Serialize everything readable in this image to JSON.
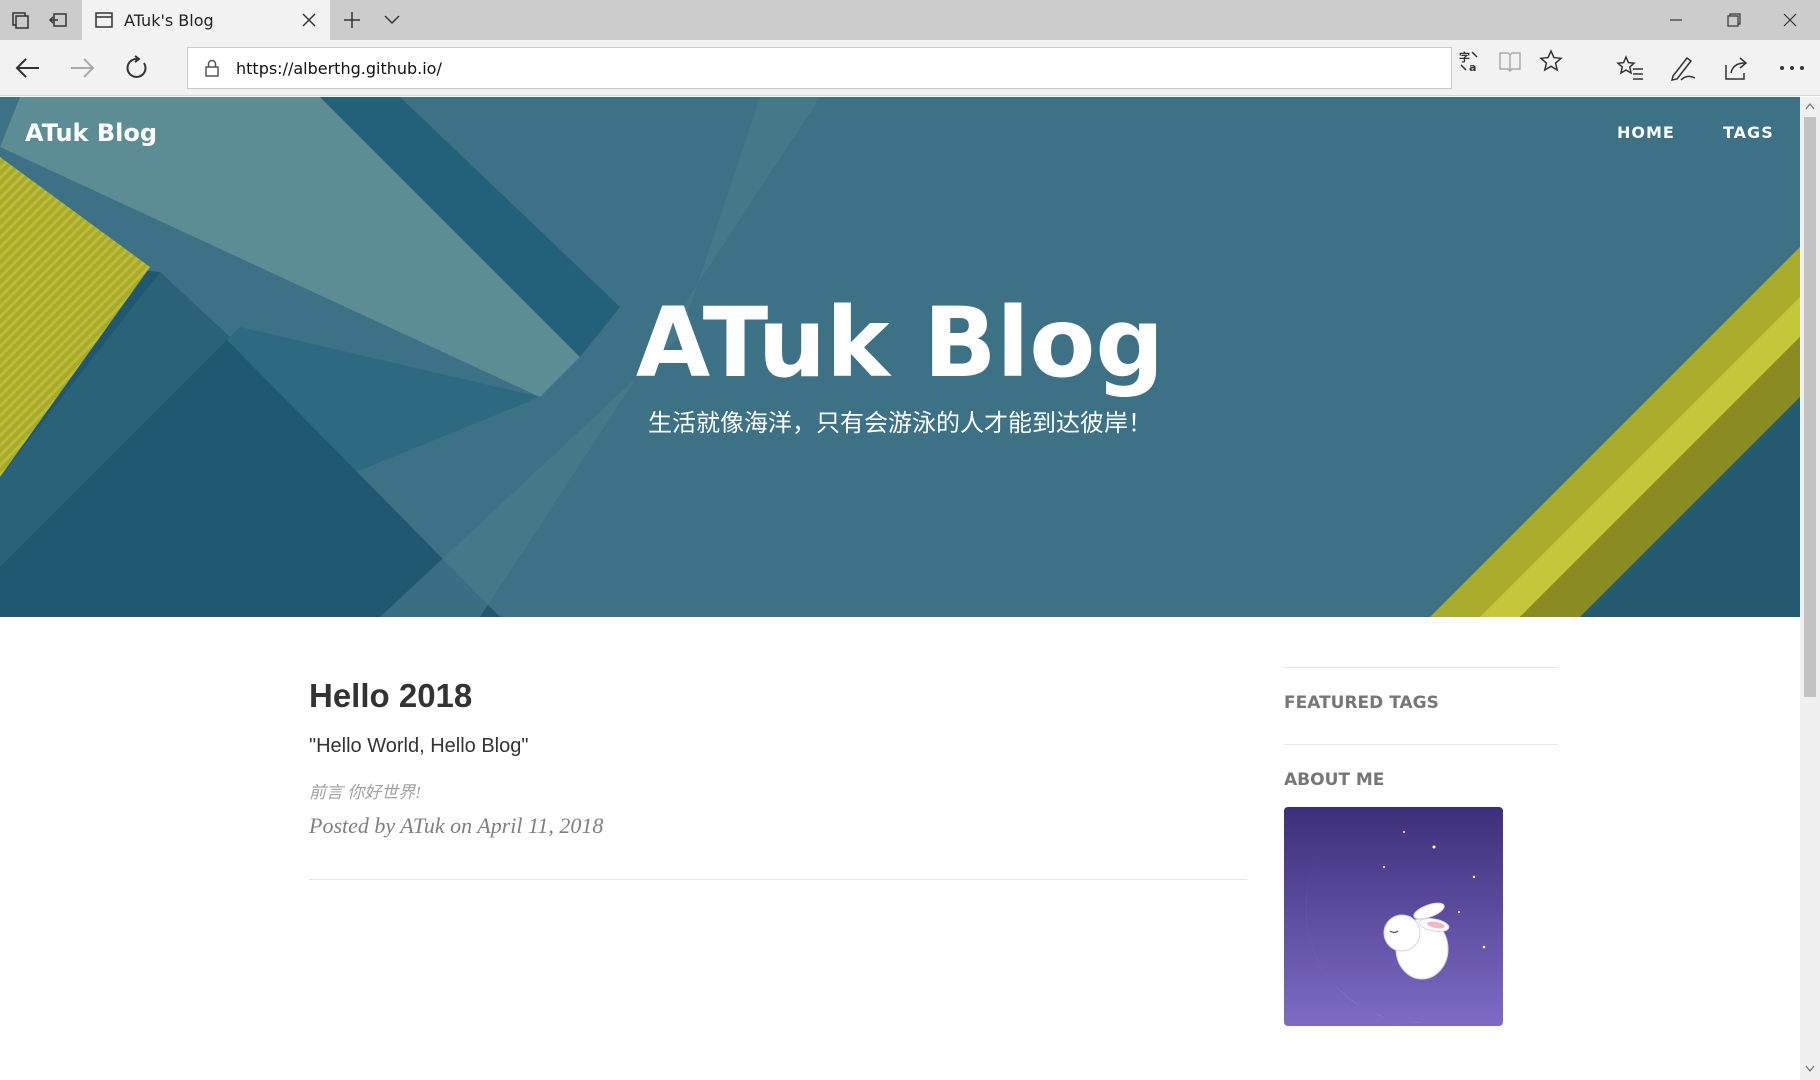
{
  "browser": {
    "tab_title": "ATuk's Blog",
    "url": "https://alberthg.github.io/"
  },
  "site": {
    "brand": "ATuk Blog",
    "nav": [
      "HOME",
      "TAGS"
    ],
    "hero_title": "ATuk Blog",
    "hero_subtitle": "生活就像海洋，只有会游泳的人才能到达彼岸！"
  },
  "post": {
    "title": "Hello 2018",
    "subtitle": "\"Hello World, Hello Blog\"",
    "excerpt": "前言 你好世界!",
    "meta": "Posted by ATuk on April 11, 2018"
  },
  "sidebar": {
    "featured_tags_heading": "FEATURED TAGS",
    "about_heading": "ABOUT ME"
  },
  "colors": {
    "hero_teal": "#3b7185",
    "accent_yellow": "#b3b52e"
  }
}
